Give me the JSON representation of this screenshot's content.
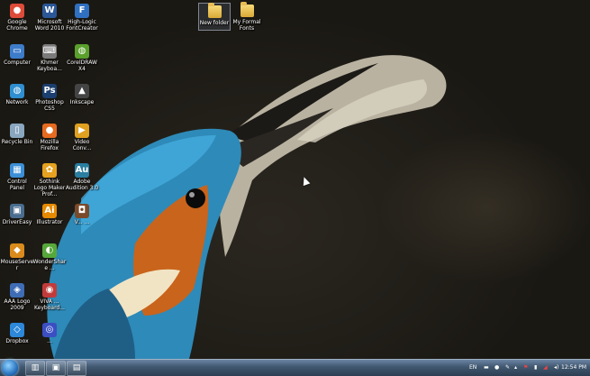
{
  "desktop": {
    "icons_col1": [
      {
        "label": "Google Chrome",
        "glyph": "●",
        "color": "#dd4b39",
        "icon": "chrome-icon"
      },
      {
        "label": "Computer",
        "glyph": "▭",
        "color": "#3d7cc9",
        "icon": "computer-icon"
      },
      {
        "label": "Network",
        "glyph": "◍",
        "color": "#2f8fd0",
        "icon": "network-icon"
      },
      {
        "label": "Recycle Bin",
        "glyph": "▯",
        "color": "#8aa7bf",
        "icon": "recycle-bin-icon"
      },
      {
        "label": "Control Panel",
        "glyph": "▦",
        "color": "#3c8fd6",
        "icon": "control-panel-icon"
      },
      {
        "label": "DriverEasy",
        "glyph": "▣",
        "color": "#4a6d8f",
        "icon": "drivereasy-icon"
      },
      {
        "label": "MouseServer",
        "glyph": "◆",
        "color": "#d98b1c",
        "icon": "mouseserver-icon"
      },
      {
        "label": "AAA Logo 2009",
        "glyph": "◈",
        "color": "#3e6db5",
        "icon": "aaa-logo-icon"
      },
      {
        "label": "Dropbox",
        "glyph": "◇",
        "color": "#2d88d9",
        "icon": "dropbox-icon"
      }
    ],
    "icons_col2": [
      {
        "label": "Microsoft Word 2010",
        "glyph": "W",
        "color": "#2b5797",
        "icon": "word-icon"
      },
      {
        "label": "Khmer Keyboa...",
        "glyph": "⌨",
        "color": "#7a7a7a",
        "icon": "keyboard-icon"
      },
      {
        "label": "Photoshop CS5",
        "glyph": "Ps",
        "color": "#1b3f6e",
        "icon": "photoshop-icon"
      },
      {
        "label": "Mozilla Firefox",
        "glyph": "●",
        "color": "#e66a1f",
        "icon": "firefox-icon"
      },
      {
        "label": "Sothink Logo Maker Prof...",
        "glyph": "✿",
        "color": "#e6a21f",
        "icon": "sothink-icon"
      },
      {
        "label": "Illustrator",
        "glyph": "Ai",
        "color": "#e58a00",
        "icon": "illustrator-icon"
      },
      {
        "label": "WonderShare ...",
        "glyph": "◐",
        "color": "#56a83a",
        "icon": "wondershare-icon"
      },
      {
        "label": "VIVA ... Keyboard...",
        "glyph": "◉",
        "color": "#c23b3b",
        "icon": "viva-keyboard-icon"
      },
      {
        "label": "...",
        "glyph": "◎",
        "color": "#3b4fc2",
        "icon": "app-icon"
      }
    ],
    "icons_col3": [
      {
        "label": "High-Logic FontCreator",
        "glyph": "F",
        "color": "#3070c0",
        "icon": "fontcreator-icon"
      },
      {
        "label": "CorelDRAW X4",
        "glyph": "◍",
        "color": "#5aa02c",
        "icon": "coreldraw-icon"
      },
      {
        "label": "Inkscape",
        "glyph": "▲",
        "color": "#444444",
        "icon": "inkscape-icon"
      },
      {
        "label": "Video Conv...",
        "glyph": "▶",
        "color": "#e0a020",
        "icon": "video-converter-icon"
      },
      {
        "label": "Adobe Audition 3.0",
        "glyph": "Au",
        "color": "#2a7ea0",
        "icon": "audition-icon"
      },
      {
        "label": "V... ...",
        "glyph": "◘",
        "color": "#7a4a2a",
        "icon": "video-file-icon"
      }
    ],
    "folders": [
      {
        "label": "New folder",
        "icon": "folder-icon"
      },
      {
        "label": "My Formal Fonts",
        "icon": "folder-icon"
      }
    ]
  },
  "taskbar": {
    "buttons": [
      {
        "glyph": "▥",
        "icon": "explorer-icon"
      },
      {
        "glyph": "▣",
        "icon": "media-icon"
      },
      {
        "glyph": "▤",
        "icon": "window-icon"
      }
    ],
    "tray": {
      "language": "EN",
      "time": "12:54 PM"
    }
  }
}
